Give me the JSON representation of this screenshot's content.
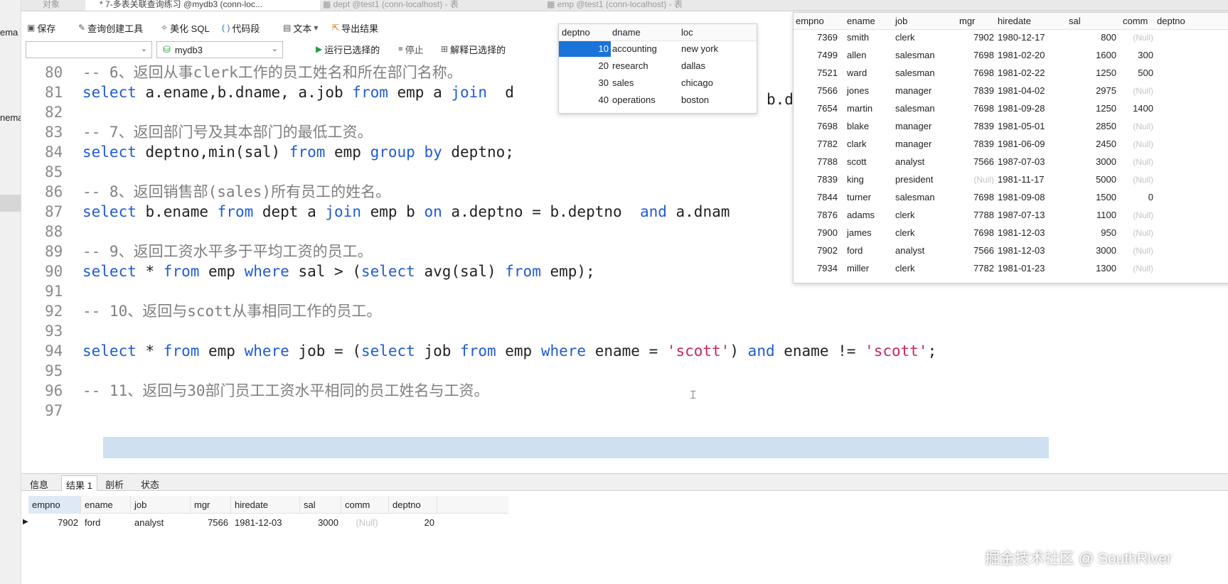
{
  "sidebar": {
    "labels": [
      "ema",
      "nema"
    ]
  },
  "tabs": [
    {
      "label": "对象"
    },
    {
      "label": "* 7-多表关联查询练习 @mydb3 (conn-loc..."
    },
    {
      "label": "dept @test1 (conn-localhost) - 表"
    },
    {
      "label": "emp @test1 (conn-localhost) - 表"
    }
  ],
  "toolbar": {
    "save": "保存",
    "query_builder": "查询创建工具",
    "beautify": "美化 SQL",
    "snippet": "代码段",
    "text": "文本",
    "export": "导出结果",
    "database": "mydb3",
    "run_selected": "运行已选择的",
    "stop": "停止",
    "explain_selected": "解释已选择的"
  },
  "editor": {
    "lines": [
      {
        "no": "80",
        "parts": [
          {
            "t": "-- 6、返回从事clerk工作的员工姓名和所在部门名称。",
            "c": "cm"
          }
        ]
      },
      {
        "no": "81",
        "parts": [
          {
            "t": "select",
            "c": "kw"
          },
          {
            "t": " a.ename,b.dname, a.job ",
            "c": ""
          },
          {
            "t": "from",
            "c": "kw"
          },
          {
            "t": " emp a ",
            "c": ""
          },
          {
            "t": "join",
            "c": "kw"
          },
          {
            "t": "  d",
            "c": ""
          }
        ]
      },
      {
        "no": "82",
        "parts": []
      },
      {
        "no": "83",
        "parts": [
          {
            "t": "-- 7、返回部门号及其本部门的最低工资。",
            "c": "cm"
          }
        ]
      },
      {
        "no": "84",
        "parts": [
          {
            "t": "select",
            "c": "kw"
          },
          {
            "t": " deptno,min(sal) ",
            "c": ""
          },
          {
            "t": "from",
            "c": "kw"
          },
          {
            "t": " emp ",
            "c": ""
          },
          {
            "t": "group by",
            "c": "kw"
          },
          {
            "t": " deptno;",
            "c": ""
          }
        ]
      },
      {
        "no": "85",
        "parts": []
      },
      {
        "no": "86",
        "parts": [
          {
            "t": "-- 8、返回销售部(sales)所有员工的姓名。",
            "c": "cm"
          }
        ]
      },
      {
        "no": "87",
        "parts": [
          {
            "t": "select",
            "c": "kw"
          },
          {
            "t": " b.ename ",
            "c": ""
          },
          {
            "t": "from",
            "c": "kw"
          },
          {
            "t": " dept a ",
            "c": ""
          },
          {
            "t": "join",
            "c": "kw"
          },
          {
            "t": " emp b ",
            "c": ""
          },
          {
            "t": "on",
            "c": "kw"
          },
          {
            "t": " a.deptno = b.deptno  ",
            "c": ""
          },
          {
            "t": "and",
            "c": "kw"
          },
          {
            "t": " a.dnam",
            "c": ""
          }
        ]
      },
      {
        "no": "88",
        "parts": []
      },
      {
        "no": "89",
        "parts": [
          {
            "t": "-- 9、返回工资水平多于平均工资的员工。",
            "c": "cm"
          }
        ]
      },
      {
        "no": "90",
        "parts": [
          {
            "t": "select",
            "c": "kw"
          },
          {
            "t": " * ",
            "c": ""
          },
          {
            "t": "from",
            "c": "kw"
          },
          {
            "t": " emp ",
            "c": ""
          },
          {
            "t": "where",
            "c": "kw"
          },
          {
            "t": " sal > (",
            "c": ""
          },
          {
            "t": "select",
            "c": "kw"
          },
          {
            "t": " avg(sal) ",
            "c": ""
          },
          {
            "t": "from",
            "c": "kw"
          },
          {
            "t": " emp);",
            "c": ""
          }
        ]
      },
      {
        "no": "91",
        "parts": []
      },
      {
        "no": "92",
        "parts": [
          {
            "t": "-- 10、返回与scott从事相同工作的员工。",
            "c": "cm"
          }
        ]
      },
      {
        "no": "93",
        "parts": []
      },
      {
        "no": "94",
        "parts": [
          {
            "t": "select",
            "c": "kw"
          },
          {
            "t": " * ",
            "c": ""
          },
          {
            "t": "from",
            "c": "kw"
          },
          {
            "t": " emp ",
            "c": ""
          },
          {
            "t": "where",
            "c": "kw"
          },
          {
            "t": " job = (",
            "c": ""
          },
          {
            "t": "select",
            "c": "kw"
          },
          {
            "t": " job ",
            "c": ""
          },
          {
            "t": "from",
            "c": "kw"
          },
          {
            "t": " emp ",
            "c": ""
          },
          {
            "t": "where",
            "c": "kw"
          },
          {
            "t": " ename = ",
            "c": ""
          },
          {
            "t": "'scott'",
            "c": "st"
          },
          {
            "t": ") ",
            "c": ""
          },
          {
            "t": "and",
            "c": "kw"
          },
          {
            "t": " ename != ",
            "c": ""
          },
          {
            "t": "'scott'",
            "c": "st"
          },
          {
            "t": ";",
            "c": ""
          }
        ]
      },
      {
        "no": "95",
        "parts": []
      },
      {
        "no": "96",
        "parts": [
          {
            "t": "-- 11、返回与30部门员工工资水平相同的员工姓名与工资。",
            "c": "cm"
          }
        ]
      },
      {
        "no": "97",
        "parts": []
      }
    ]
  },
  "dept_popup": {
    "columns": [
      "deptno",
      "dname",
      "loc"
    ],
    "rows": [
      [
        "10",
        "accounting",
        "new york"
      ],
      [
        "20",
        "research",
        "dallas"
      ],
      [
        "30",
        "sales",
        "chicago"
      ],
      [
        "40",
        "operations",
        "boston"
      ]
    ],
    "trailing_text": "b.d"
  },
  "emp_popup": {
    "columns": [
      "empno",
      "ename",
      "job",
      "mgr",
      "hiredate",
      "sal",
      "comm",
      "deptno"
    ],
    "rows": [
      [
        "7369",
        "smith",
        "clerk",
        "7902",
        "1980-12-17",
        "800",
        "(Null)"
      ],
      [
        "7499",
        "allen",
        "salesman",
        "7698",
        "1981-02-20",
        "1600",
        "300"
      ],
      [
        "7521",
        "ward",
        "salesman",
        "7698",
        "1981-02-22",
        "1250",
        "500"
      ],
      [
        "7566",
        "jones",
        "manager",
        "7839",
        "1981-04-02",
        "2975",
        "(Null)"
      ],
      [
        "7654",
        "martin",
        "salesman",
        "7698",
        "1981-09-28",
        "1250",
        "1400"
      ],
      [
        "7698",
        "blake",
        "manager",
        "7839",
        "1981-05-01",
        "2850",
        "(Null)"
      ],
      [
        "7782",
        "clark",
        "manager",
        "7839",
        "1981-06-09",
        "2450",
        "(Null)"
      ],
      [
        "7788",
        "scott",
        "analyst",
        "7566",
        "1987-07-03",
        "3000",
        "(Null)"
      ],
      [
        "7839",
        "king",
        "president",
        "(Null)",
        "1981-11-17",
        "5000",
        "(Null)"
      ],
      [
        "7844",
        "turner",
        "salesman",
        "7698",
        "1981-09-08",
        "1500",
        "0"
      ],
      [
        "7876",
        "adams",
        "clerk",
        "7788",
        "1987-07-13",
        "1100",
        "(Null)"
      ],
      [
        "7900",
        "james",
        "clerk",
        "7698",
        "1981-12-03",
        "950",
        "(Null)"
      ],
      [
        "7902",
        "ford",
        "analyst",
        "7566",
        "1981-12-03",
        "3000",
        "(Null)"
      ],
      [
        "7934",
        "miller",
        "clerk",
        "7782",
        "1981-01-23",
        "1300",
        "(Null)"
      ]
    ]
  },
  "result_tabs": [
    "信息",
    "结果 1",
    "剖析",
    "状态"
  ],
  "result": {
    "columns": [
      "empno",
      "ename",
      "job",
      "mgr",
      "hiredate",
      "sal",
      "comm",
      "deptno"
    ],
    "rows": [
      [
        "7902",
        "ford",
        "analyst",
        "7566",
        "1981-12-03",
        "3000",
        "(Null)",
        "20"
      ]
    ]
  },
  "watermark": "掘金技术社区 @ SouthRiver"
}
